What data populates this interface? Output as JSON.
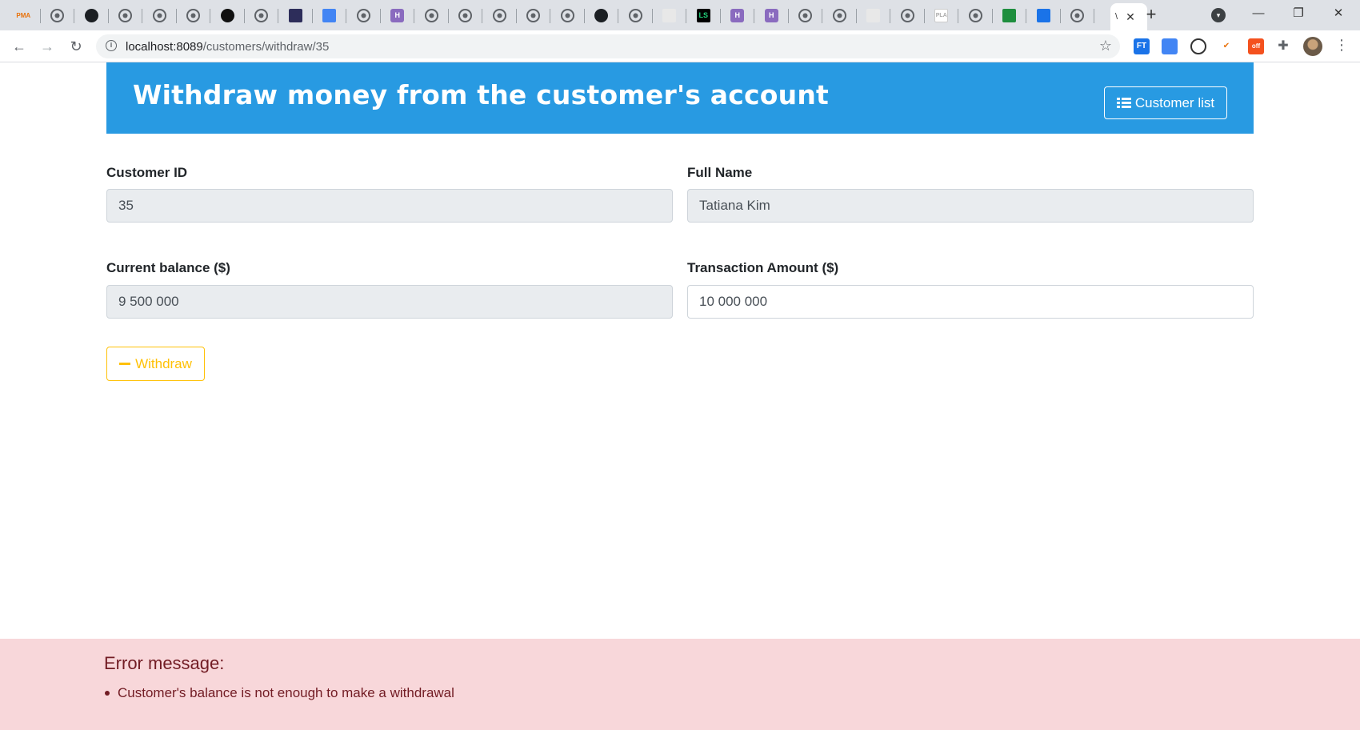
{
  "browser": {
    "active_tab_title": "\\",
    "url_host": "localhost:8089",
    "url_path": "/customers/withdraw/35",
    "tab_icons": [
      "pma-icon",
      "globe-icon",
      "github-icon",
      "globe-icon",
      "globe-icon",
      "globe-icon",
      "black-circle-icon",
      "globe-icon",
      "dark-square-icon",
      "google-translate-icon",
      "globe-icon",
      "h-icon",
      "globe-icon",
      "globe-icon",
      "globe-icon",
      "globe-icon",
      "globe-icon",
      "github-icon",
      "globe-icon",
      "image-icon",
      "ls-icon",
      "h-icon",
      "h-icon",
      "globe-icon",
      "globe-icon",
      "image-icon",
      "globe-icon",
      "pla-icon",
      "globe-icon",
      "green-square-icon",
      "blue-square-icon",
      "globe-icon"
    ],
    "tab_label_pma": "PMA",
    "tab_label_pla": "PLA",
    "tab_label_ls": "LS",
    "tab_label_h": "H",
    "extensions": {
      "ft": "FT",
      "off_badge": "off"
    }
  },
  "header": {
    "title": "Withdraw money from the customer's account",
    "list_button": "Customer list"
  },
  "form": {
    "customer_id_label": "Customer ID",
    "customer_id_value": "35",
    "full_name_label": "Full Name",
    "full_name_value": "Tatiana Kim",
    "balance_label": "Current balance ($)",
    "balance_value": "9 500 000",
    "amount_label": "Transaction Amount ($)",
    "amount_value": "10 000 000",
    "withdraw_button": "Withdraw"
  },
  "error": {
    "title": "Error message:",
    "messages": [
      "Customer's balance is not enough to make a withdrawal"
    ]
  },
  "colors": {
    "header_bg": "#289ae2",
    "withdraw_accent": "#ffc107",
    "error_bg": "#f8d7da",
    "error_text": "#721c24"
  }
}
